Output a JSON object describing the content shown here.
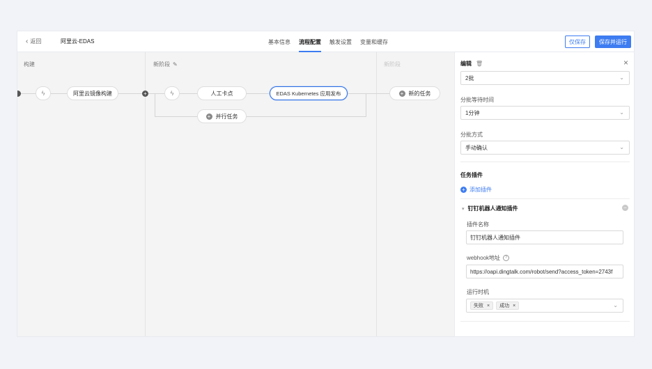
{
  "header": {
    "back_label": "返回",
    "title": "阿里云-EDAS",
    "tabs": [
      "基本信息",
      "流程配置",
      "触发设置",
      "变量和缓存"
    ],
    "save_label": "仅保存",
    "save_run_label": "保存并运行"
  },
  "canvas": {
    "stages": [
      {
        "title": "构建",
        "nodes": [
          "阿里云镜像构建"
        ]
      },
      {
        "title": "新阶段",
        "nodes": [
          "人工卡点",
          "EDAS Kubernetes 应用发布"
        ],
        "parallel_label": "并行任务"
      },
      {
        "title": "新阶段",
        "new_task_label": "新的任务"
      }
    ],
    "trigger_icon": "ϟ"
  },
  "panel": {
    "title": "编辑",
    "fields": {
      "batch_count_value": "2批",
      "batch_wait_label": "分批等待时间",
      "batch_wait_value": "1分钟",
      "batch_mode_label": "分批方式",
      "batch_mode_value": "手动确认"
    },
    "plugins_title": "任务插件",
    "add_plugin_label": "添加插件",
    "plugin": {
      "title": "钉钉机器人通知插件",
      "name_label": "插件名称",
      "name_value": "钉钉机器人通知插件",
      "webhook_label": "webhook地址",
      "webhook_value": "https://oapi.dingtalk.com/robot/send?access_token=2743f",
      "timing_label": "运行时机",
      "timing_tags": [
        "失败",
        "成功"
      ]
    }
  },
  "colors": {
    "accent": "#3d7cf1",
    "canvas_bg": "#f4f4f4"
  }
}
